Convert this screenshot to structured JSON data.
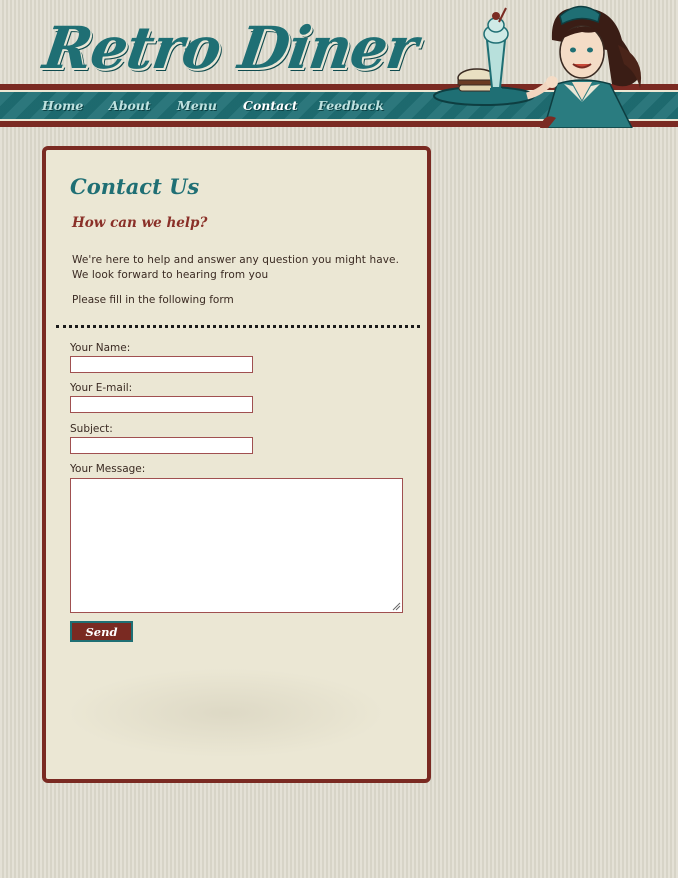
{
  "brand": {
    "logo_text": "Retro Diner"
  },
  "nav": {
    "items": [
      {
        "label": "Home"
      },
      {
        "label": "About"
      },
      {
        "label": "Menu"
      },
      {
        "label": "Contact"
      },
      {
        "label": "Feedback"
      }
    ],
    "active": "Contact"
  },
  "colors": {
    "teal": "#1f6f74",
    "maroon": "#7a2a22",
    "panel_bg": "#ebe7d4",
    "page_bg": "#dedbcd"
  },
  "contact": {
    "title": "Contact Us",
    "subtitle": "How can we help?",
    "intro": "We're here to help and answer any question you might have. We look forward to hearing from you",
    "instruction": "Please fill in the following form"
  },
  "form": {
    "name_label": "Your Name:",
    "name_value": "",
    "email_label": "Your E-mail:",
    "email_value": "",
    "subject_label": "Subject:",
    "subject_value": "",
    "message_label": "Your Message:",
    "message_value": "",
    "send_label": "Send"
  },
  "icons": {
    "mascot": "waitress-illustration-icon",
    "resize": "resize-handle-icon"
  }
}
